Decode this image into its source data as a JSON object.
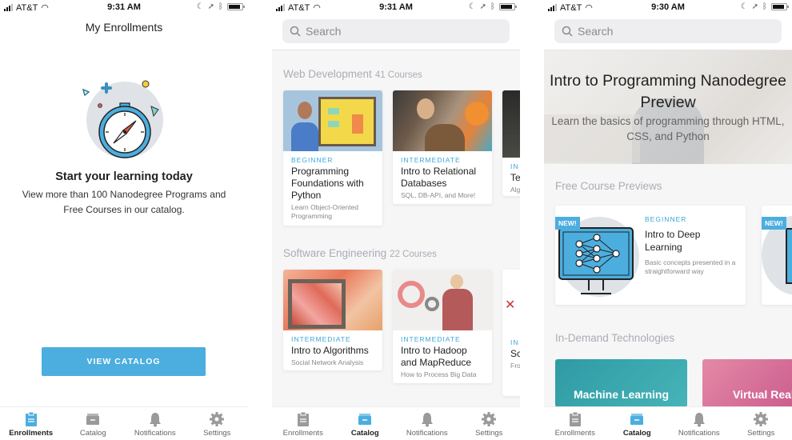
{
  "status_bars": [
    {
      "carrier": "AT&T",
      "time": "9:31 AM",
      "battery_percent": 90
    },
    {
      "carrier": "AT&T",
      "time": "9:31 AM",
      "battery_percent": 90
    },
    {
      "carrier": "AT&T",
      "time": "9:30 AM",
      "battery_percent": 90
    }
  ],
  "enrollments_screen": {
    "title": "My Enrollments",
    "empty_title": "Start your learning today",
    "empty_description": "View more than 100 Nanodegree Programs and Free Courses in our catalog.",
    "cta_label": "VIEW CATALOG",
    "illustration": "stopwatch-compass-icon"
  },
  "tabs": [
    {
      "label": "Enrollments",
      "icon": "clipboard-icon"
    },
    {
      "label": "Catalog",
      "icon": "drawer-icon"
    },
    {
      "label": "Notifications",
      "icon": "bell-icon"
    },
    {
      "label": "Settings",
      "icon": "gear-icon"
    }
  ],
  "active_tab_by_screen": [
    "Enrollments",
    "Catalog",
    "Catalog"
  ],
  "colors": {
    "accent": "#4baedf",
    "level_text": "#3aa7d9",
    "section_title": "#a9adb3",
    "active_icon": "#4baedf",
    "inactive_icon": "#9a9a9a"
  },
  "search": {
    "placeholder": "Search"
  },
  "catalog_screen": {
    "sections": [
      {
        "title": "Web Development",
        "count": "41 Courses",
        "courses": [
          {
            "level": "BEGINNER",
            "name": "Programming Foundations with Python",
            "subtitle": "Learn Object-Oriented Programming"
          },
          {
            "level": "INTERMEDIATE",
            "name": "Intro to Relational Databases",
            "subtitle": "SQL, DB-API, and More!"
          },
          {
            "level": "IN",
            "name": "Te",
            "subtitle": "Alg Str"
          }
        ]
      },
      {
        "title": "Software Engineering",
        "count": "22 Courses",
        "courses": [
          {
            "level": "INTERMEDIATE",
            "name": "Intro to Algorithms",
            "subtitle": "Social Network Analysis"
          },
          {
            "level": "INTERMEDIATE",
            "name": "Intro to Hadoop and MapReduce",
            "subtitle": "How to Process Big Data"
          },
          {
            "level": "IN",
            "name": "Sc De Pr",
            "subtitle": "Fro"
          }
        ]
      }
    ]
  },
  "featured_screen": {
    "hero_title": "Intro to Programming Nanodegree Preview",
    "hero_subtitle": "Learn the basics of programming through HTML, CSS, and Python",
    "previews_title": "Free Course Previews",
    "previews": [
      {
        "badge": "NEW!",
        "level": "BEGINNER",
        "name": "Intro to Deep Learning",
        "subtitle": "Basic concepts presented in a straightforward way"
      },
      {
        "badge": "NEW!"
      }
    ],
    "tech_title": "In-Demand Technologies",
    "technologies": [
      {
        "label": "Machine Learning",
        "color": "#3aa5ad"
      },
      {
        "label": "Virtual Reality",
        "color": "#d5628f"
      }
    ]
  }
}
